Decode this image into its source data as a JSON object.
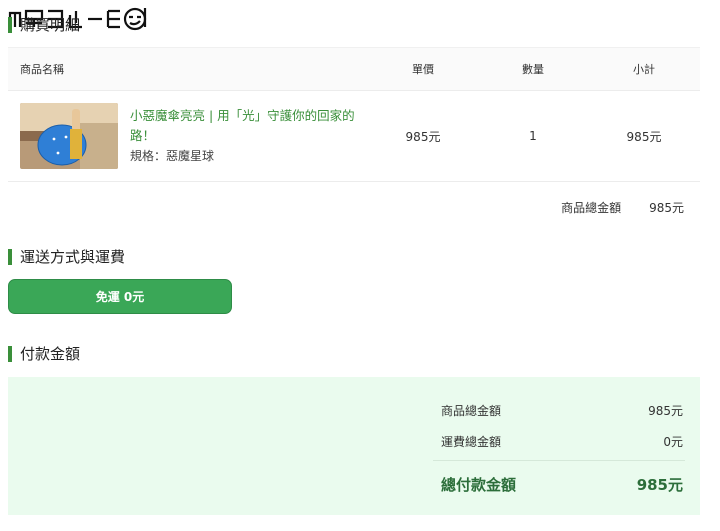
{
  "order_details": {
    "title": "購買明細"
  },
  "table": {
    "headers": {
      "name": "商品名稱",
      "price": "單價",
      "qty": "數量",
      "subtotal": "小計"
    },
    "item": {
      "name": "小惡魔傘亮亮 | 用「光」守護你的回家的路！",
      "spec": "規格：惡魔星球",
      "price": "985元",
      "qty": "1",
      "subtotal": "985元"
    }
  },
  "goods_total": {
    "label": "商品總金額",
    "value": "985元"
  },
  "shipping": {
    "title": "運送方式與運費",
    "option_label": "免運 0元"
  },
  "payment": {
    "title": "付款金額",
    "goods_label": "商品總金額",
    "goods_value": "985元",
    "shipping_label": "運費總金額",
    "shipping_value": "0元",
    "total_label": "總付款金額",
    "total_value": "985元"
  },
  "colors": {
    "accent": "#3aa757",
    "title_bar": "#3a8f3a",
    "payment_bg": "#eafbee",
    "total_text": "#2c6e3a"
  },
  "icons": {
    "logo": "site-logo"
  }
}
